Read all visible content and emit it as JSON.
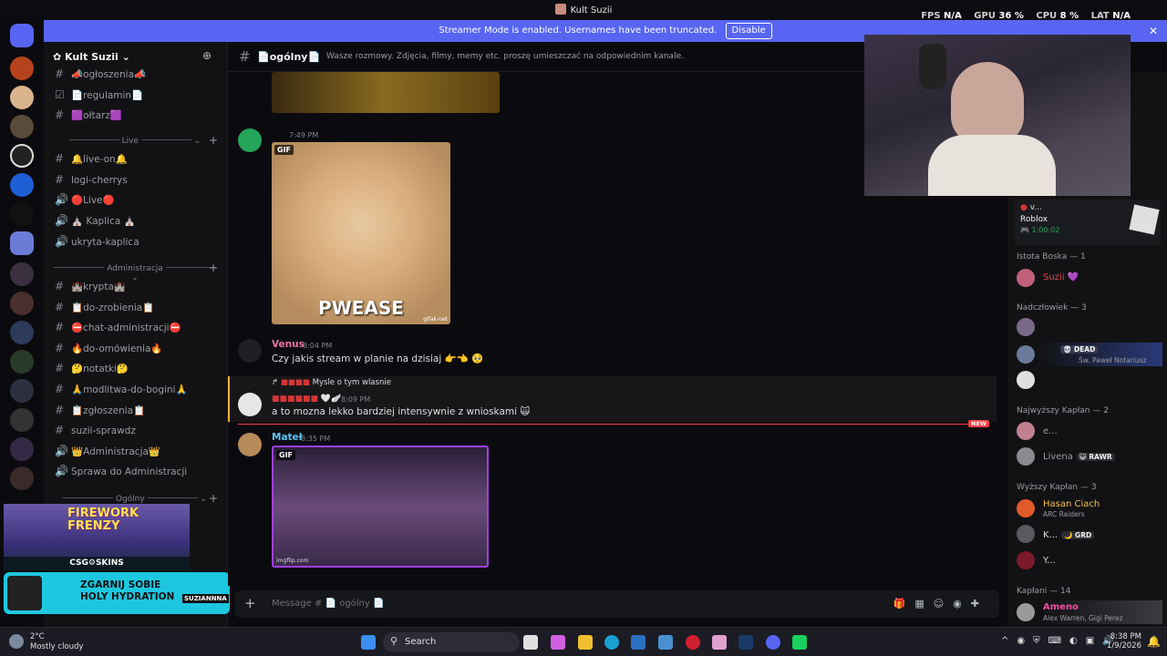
{
  "window": {
    "title": "Kult Suzii"
  },
  "hud": {
    "fps_label": "FPS",
    "fps_value": "N/A",
    "gpu_label": "GPU",
    "gpu_value": "36 %",
    "cpu_label": "CPU",
    "cpu_value": "8 %",
    "lat_label": "LAT",
    "lat_value": "N/A"
  },
  "banner": {
    "text": "Streamer Mode is enabled. Usernames have been truncated.",
    "button": "Disable",
    "close": "✕"
  },
  "server": {
    "name": "Kult Suzii"
  },
  "channels_top": [
    {
      "icon": "#",
      "label": "📣ogłoszenia📣"
    },
    {
      "icon": "☑",
      "label": "📄regulamin📄"
    },
    {
      "icon": "#",
      "label": "🟪ołtarz🟪"
    }
  ],
  "category_live": "Live",
  "channels_live": [
    {
      "icon": "#",
      "label": "🔔live-on🔔"
    },
    {
      "icon": "#",
      "label": "logi-cherrys"
    },
    {
      "icon": "🔊",
      "label": "🔴Live🔴"
    },
    {
      "icon": "🔊",
      "label": "⛪ Kaplica ⛪"
    },
    {
      "icon": "🔊",
      "label": "ukryta-kaplica"
    }
  ],
  "category_admin": "Administracja",
  "channels_admin": [
    {
      "icon": "#",
      "label": "🏰krypta🏰"
    },
    {
      "icon": "#",
      "label": "📋do-zrobienia📋"
    },
    {
      "icon": "#",
      "label": "⛔chat-administracji⛔"
    },
    {
      "icon": "#",
      "label": "🔥do-omówienia🔥"
    },
    {
      "icon": "#",
      "label": "🤔notatki🤔"
    },
    {
      "icon": "#",
      "label": "🙏modlitwa-do-bogini🙏"
    },
    {
      "icon": "#",
      "label": "📋zgłoszenia📋"
    },
    {
      "icon": "#",
      "label": "suzii-sprawdz"
    },
    {
      "icon": "🔊",
      "label": "👑Administracja👑"
    },
    {
      "icon": "🔊",
      "label": "Sprawa do Administracji"
    }
  ],
  "category_general": "Ogólny",
  "channel_header": {
    "name": "📄ogólny📄",
    "topic": "Wasze rozmowy. Zdjęcia, filmy, memy etc. proszę umieszczać na odpowiednim kanale."
  },
  "messages": [
    {
      "time": "7:49 PM",
      "gif_tag": "GIF",
      "gif_caption": "PWEASE",
      "gif_watermark": "gifak-net"
    },
    {
      "author": "Venus",
      "time": "8:04 PM",
      "text": "Czy jakis stream w planie na dzisiaj 👉👈 🥺"
    },
    {
      "reply_text": "Mysle o tym wlasnie",
      "time": "8:09 PM",
      "text": "a to mozna lekko bardziej intensywnie z wnioskami 🙀"
    },
    {
      "author": "Mateł",
      "time": "8:35 PM",
      "gif_tag": "GIF",
      "gif_watermark": "imgflip.com"
    }
  ],
  "new_marker": "NEW",
  "input": {
    "placeholder": "Message # 📄 ogólny 📄"
  },
  "activity": {
    "user": "v...",
    "game": "Roblox",
    "elapsed": "1:00:02"
  },
  "members": [
    {
      "heading": "Istota Boska — 1"
    },
    {
      "name": "Suzii",
      "color": "#e04a4a",
      "suffix": "💜"
    },
    {
      "heading": "Nadczłowiek — 3"
    },
    {
      "badge": "💀 DEAD",
      "sub": "Św. Paweł Notariusz"
    },
    {
      "heading": "Najwyższy Kapłan — 2"
    },
    {
      "name": "e...",
      "color": "#9a9ca4"
    },
    {
      "name": "Livena",
      "color": "#9a9ca4",
      "badge": "😺 RAWR"
    },
    {
      "heading": "Wyższy Kapłan — 3"
    },
    {
      "name": "Hasan Ciach",
      "color": "#f0c24a",
      "sub": "ARC Raiders"
    },
    {
      "name": "K...",
      "color": "#dbdee1",
      "badge": "🌙 GRD"
    },
    {
      "name": "Y...",
      "color": "#dbdee1"
    },
    {
      "heading": "Kapłani — 14"
    },
    {
      "name": "Ameno",
      "color": "#f050a0",
      "sub": "Alex Warren, Gigi Perez"
    }
  ],
  "ads": {
    "ad1_title": "FIREWORK FRENZY",
    "ad1_sub": "CSG⚙SKINS",
    "ad2_text": "ZGARNIJ SOBIE HOLY HYDRATION",
    "ad2_brand": "SUZIANNNA"
  },
  "taskbar": {
    "temp": "2°C",
    "weather": "Mostly cloudy",
    "search": "Search",
    "time": "8:38 PM",
    "date": "1/9/2026"
  },
  "colors": {
    "blurple": "#5865f2",
    "sidebar": "#121214",
    "chat_bg": "#0b0b0f",
    "accent_red": "#f23f43"
  }
}
